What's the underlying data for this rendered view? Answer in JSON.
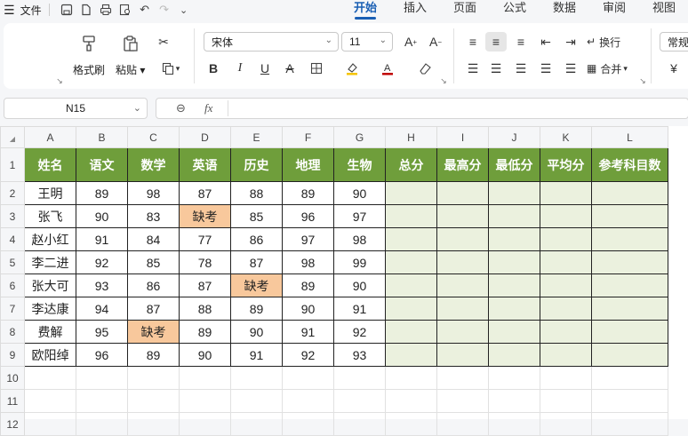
{
  "menu": {
    "file_label": "文件",
    "tabs": [
      "开始",
      "插入",
      "页面",
      "公式",
      "数据",
      "审阅",
      "视图"
    ],
    "active_tab": "开始"
  },
  "ribbon": {
    "format_painter": "格式刷",
    "paste": "粘贴",
    "font_name": "宋体",
    "font_size": "11",
    "wrap_text": "换行",
    "merge": "合并",
    "number_format": "常规"
  },
  "formula_bar": {
    "cell_ref": "N15",
    "fx": "fx",
    "value": ""
  },
  "sheet": {
    "columns": [
      "A",
      "B",
      "C",
      "D",
      "E",
      "F",
      "G",
      "H",
      "I",
      "J",
      "K",
      "L"
    ],
    "row_numbers": [
      "1",
      "2",
      "3",
      "4",
      "5",
      "6",
      "7",
      "8",
      "9",
      "10",
      "11",
      "12"
    ],
    "headers": [
      "姓名",
      "语文",
      "数学",
      "英语",
      "历史",
      "地理",
      "生物",
      "总分",
      "最高分",
      "最低分",
      "平均分",
      "参考科目数"
    ],
    "rows": [
      [
        "王明",
        "89",
        "98",
        "87",
        "88",
        "89",
        "90"
      ],
      [
        "张飞",
        "90",
        "83",
        "缺考",
        "85",
        "96",
        "97"
      ],
      [
        "赵小红",
        "91",
        "84",
        "77",
        "86",
        "97",
        "98"
      ],
      [
        "李二进",
        "92",
        "85",
        "78",
        "87",
        "98",
        "99"
      ],
      [
        "张大可",
        "93",
        "86",
        "87",
        "缺考",
        "89",
        "90"
      ],
      [
        "李达康",
        "94",
        "87",
        "88",
        "89",
        "90",
        "91"
      ],
      [
        "费解",
        "95",
        "缺考",
        "89",
        "90",
        "91",
        "92"
      ],
      [
        "欧阳绰",
        "96",
        "89",
        "90",
        "91",
        "92",
        "93"
      ]
    ],
    "colors": {
      "header_green": "#6f9e3b",
      "absent_orange": "#f8c89c",
      "calc_light_green": "#ebf1de"
    }
  }
}
